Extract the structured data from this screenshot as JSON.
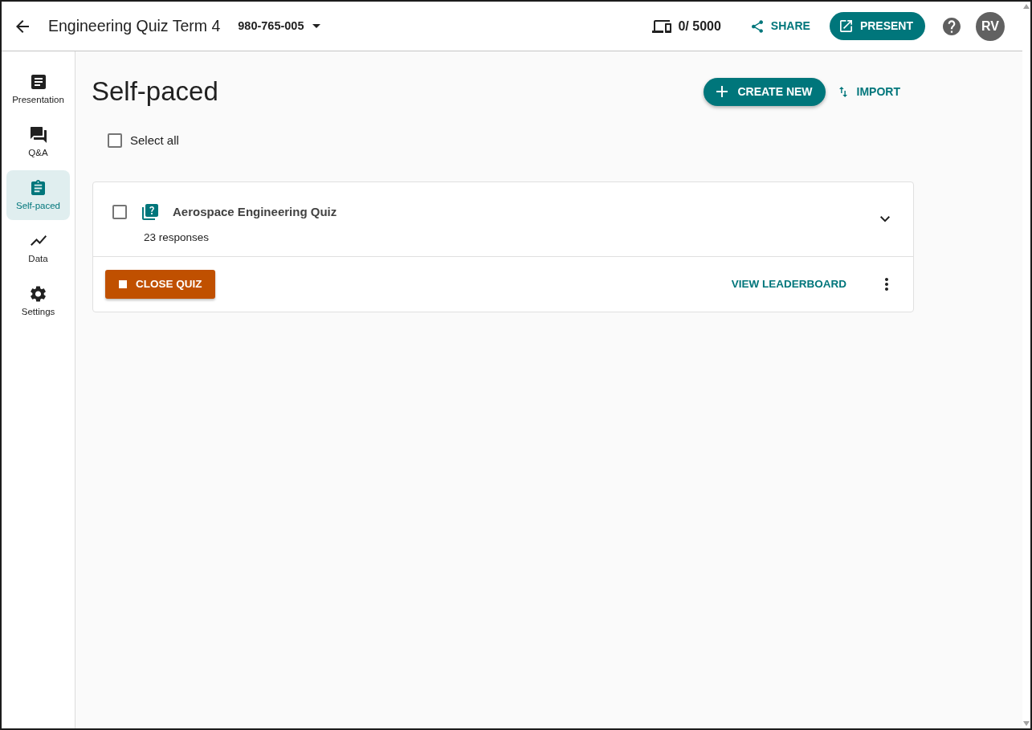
{
  "header": {
    "title": "Engineering Quiz Term 4",
    "session_code": "980-765-005",
    "participants": "0/ 5000",
    "share": "SHARE",
    "present": "PRESENT",
    "avatar": "RV"
  },
  "sidebar": {
    "items": [
      {
        "label": "Presentation",
        "selected": false
      },
      {
        "label": "Q&A",
        "selected": false
      },
      {
        "label": "Self-paced",
        "selected": true
      },
      {
        "label": "Data",
        "selected": false
      },
      {
        "label": "Settings",
        "selected": false
      }
    ]
  },
  "page": {
    "title": "Self-paced",
    "create_new": "CREATE NEW",
    "import": "IMPORT",
    "select_all": {
      "label": "Select all",
      "checked": false
    }
  },
  "quizzes": [
    {
      "title": "Aerospace Engineering Quiz",
      "responses": "23 responses",
      "checked": false,
      "expanded": false,
      "close": "CLOSE QUIZ",
      "leaderboard": "VIEW LEADERBOARD"
    }
  ]
}
